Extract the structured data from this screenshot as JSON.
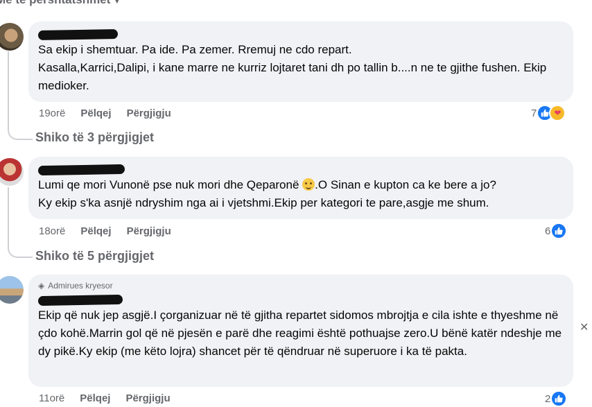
{
  "sort_label": "Më të përshtatshmet",
  "comments": [
    {
      "text": "Sa ekip i shemtuar. Pa ide. Pa zemer. Rremuj ne cdo repart.\nKasalla,Karrici,Dalipi, i kane marre ne kurriz lojtaret tani dh po tallin b....n ne te gjithe fushen. Ekip medioker.",
      "time": "19orë",
      "like_label": "Pëlqej",
      "reply_label": "Përgjigju",
      "reaction_count": "7",
      "see_replies": "Shiko të 3 përgjigjet"
    },
    {
      "text_before_emoji": "Lumi qe mori Vunonë pse nuk mori dhe Qeparonë ",
      "text_after_emoji": ".O Sinan e kupton ca ke bere a jo?\nKy ekip s'ka asnjë ndryshim nga ai i vjetshmi.Ekip per kategori te pare,asgje me shum.",
      "time": "18orë",
      "like_label": "Pëlqej",
      "reply_label": "Përgjigju",
      "reaction_count": "6",
      "see_replies": "Shiko të 5 përgjigjet"
    },
    {
      "badge": "Admirues kryesor",
      "text": "Ekip që nuk jep asgjë.I çorganizuar në të gjitha repartet sidomos mbrojtja e cila ishte e thyeshme në çdo kohë.Marrin gol që në pjesën e parë dhe reagimi është pothuajse zero.U bënë katër ndeshje me dy pikë.Ky ekip (me këto lojra) shancet për të qëndruar në superuore i ka të pakta.",
      "time": "11orë",
      "like_label": "Pëlqej",
      "reply_label": "Përgjigju",
      "reaction_count": "2"
    }
  ],
  "colors": {
    "like": "#1877f2",
    "bubble": "#f0f2f5",
    "muted": "#65676b"
  },
  "icons": [
    "like-icon",
    "care-icon",
    "chevron-down-icon",
    "gem-icon",
    "smile-emoji-icon"
  ]
}
